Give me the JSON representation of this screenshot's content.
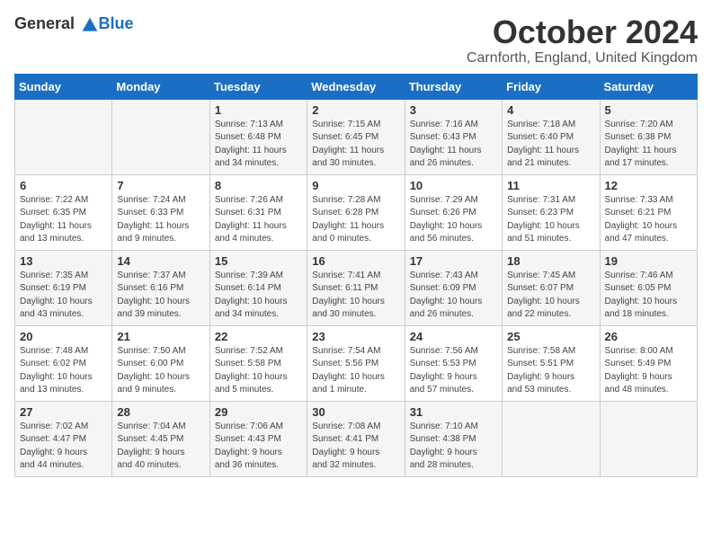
{
  "header": {
    "logo_general": "General",
    "logo_blue": "Blue",
    "month": "October 2024",
    "location": "Carnforth, England, United Kingdom"
  },
  "days_of_week": [
    "Sunday",
    "Monday",
    "Tuesday",
    "Wednesday",
    "Thursday",
    "Friday",
    "Saturday"
  ],
  "weeks": [
    [
      {
        "day": "",
        "text": ""
      },
      {
        "day": "",
        "text": ""
      },
      {
        "day": "1",
        "text": "Sunrise: 7:13 AM\nSunset: 6:48 PM\nDaylight: 11 hours\nand 34 minutes."
      },
      {
        "day": "2",
        "text": "Sunrise: 7:15 AM\nSunset: 6:45 PM\nDaylight: 11 hours\nand 30 minutes."
      },
      {
        "day": "3",
        "text": "Sunrise: 7:16 AM\nSunset: 6:43 PM\nDaylight: 11 hours\nand 26 minutes."
      },
      {
        "day": "4",
        "text": "Sunrise: 7:18 AM\nSunset: 6:40 PM\nDaylight: 11 hours\nand 21 minutes."
      },
      {
        "day": "5",
        "text": "Sunrise: 7:20 AM\nSunset: 6:38 PM\nDaylight: 11 hours\nand 17 minutes."
      }
    ],
    [
      {
        "day": "6",
        "text": "Sunrise: 7:22 AM\nSunset: 6:35 PM\nDaylight: 11 hours\nand 13 minutes."
      },
      {
        "day": "7",
        "text": "Sunrise: 7:24 AM\nSunset: 6:33 PM\nDaylight: 11 hours\nand 9 minutes."
      },
      {
        "day": "8",
        "text": "Sunrise: 7:26 AM\nSunset: 6:31 PM\nDaylight: 11 hours\nand 4 minutes."
      },
      {
        "day": "9",
        "text": "Sunrise: 7:28 AM\nSunset: 6:28 PM\nDaylight: 11 hours\nand 0 minutes."
      },
      {
        "day": "10",
        "text": "Sunrise: 7:29 AM\nSunset: 6:26 PM\nDaylight: 10 hours\nand 56 minutes."
      },
      {
        "day": "11",
        "text": "Sunrise: 7:31 AM\nSunset: 6:23 PM\nDaylight: 10 hours\nand 51 minutes."
      },
      {
        "day": "12",
        "text": "Sunrise: 7:33 AM\nSunset: 6:21 PM\nDaylight: 10 hours\nand 47 minutes."
      }
    ],
    [
      {
        "day": "13",
        "text": "Sunrise: 7:35 AM\nSunset: 6:19 PM\nDaylight: 10 hours\nand 43 minutes."
      },
      {
        "day": "14",
        "text": "Sunrise: 7:37 AM\nSunset: 6:16 PM\nDaylight: 10 hours\nand 39 minutes."
      },
      {
        "day": "15",
        "text": "Sunrise: 7:39 AM\nSunset: 6:14 PM\nDaylight: 10 hours\nand 34 minutes."
      },
      {
        "day": "16",
        "text": "Sunrise: 7:41 AM\nSunset: 6:11 PM\nDaylight: 10 hours\nand 30 minutes."
      },
      {
        "day": "17",
        "text": "Sunrise: 7:43 AM\nSunset: 6:09 PM\nDaylight: 10 hours\nand 26 minutes."
      },
      {
        "day": "18",
        "text": "Sunrise: 7:45 AM\nSunset: 6:07 PM\nDaylight: 10 hours\nand 22 minutes."
      },
      {
        "day": "19",
        "text": "Sunrise: 7:46 AM\nSunset: 6:05 PM\nDaylight: 10 hours\nand 18 minutes."
      }
    ],
    [
      {
        "day": "20",
        "text": "Sunrise: 7:48 AM\nSunset: 6:02 PM\nDaylight: 10 hours\nand 13 minutes."
      },
      {
        "day": "21",
        "text": "Sunrise: 7:50 AM\nSunset: 6:00 PM\nDaylight: 10 hours\nand 9 minutes."
      },
      {
        "day": "22",
        "text": "Sunrise: 7:52 AM\nSunset: 5:58 PM\nDaylight: 10 hours\nand 5 minutes."
      },
      {
        "day": "23",
        "text": "Sunrise: 7:54 AM\nSunset: 5:56 PM\nDaylight: 10 hours\nand 1 minute."
      },
      {
        "day": "24",
        "text": "Sunrise: 7:56 AM\nSunset: 5:53 PM\nDaylight: 9 hours\nand 57 minutes."
      },
      {
        "day": "25",
        "text": "Sunrise: 7:58 AM\nSunset: 5:51 PM\nDaylight: 9 hours\nand 53 minutes."
      },
      {
        "day": "26",
        "text": "Sunrise: 8:00 AM\nSunset: 5:49 PM\nDaylight: 9 hours\nand 48 minutes."
      }
    ],
    [
      {
        "day": "27",
        "text": "Sunrise: 7:02 AM\nSunset: 4:47 PM\nDaylight: 9 hours\nand 44 minutes."
      },
      {
        "day": "28",
        "text": "Sunrise: 7:04 AM\nSunset: 4:45 PM\nDaylight: 9 hours\nand 40 minutes."
      },
      {
        "day": "29",
        "text": "Sunrise: 7:06 AM\nSunset: 4:43 PM\nDaylight: 9 hours\nand 36 minutes."
      },
      {
        "day": "30",
        "text": "Sunrise: 7:08 AM\nSunset: 4:41 PM\nDaylight: 9 hours\nand 32 minutes."
      },
      {
        "day": "31",
        "text": "Sunrise: 7:10 AM\nSunset: 4:38 PM\nDaylight: 9 hours\nand 28 minutes."
      },
      {
        "day": "",
        "text": ""
      },
      {
        "day": "",
        "text": ""
      }
    ]
  ]
}
